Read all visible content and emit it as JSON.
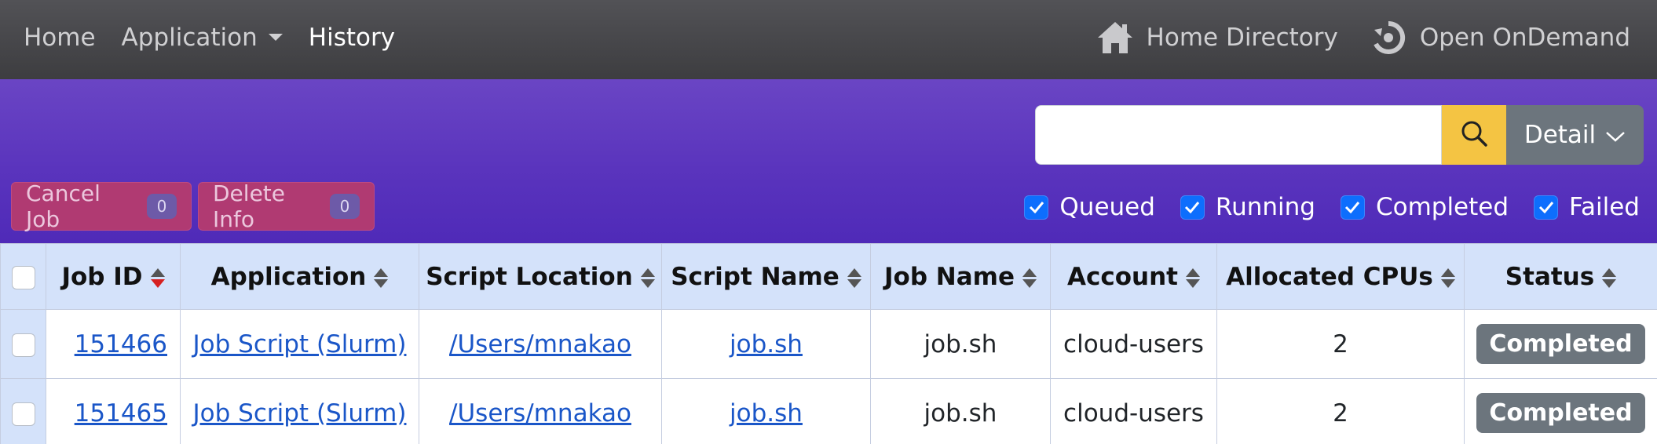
{
  "navbar": {
    "home": "Home",
    "application": "Application",
    "history": "History",
    "home_directory": "Home Directory",
    "open_ondemand": "Open OnDemand"
  },
  "toolbar": {
    "search_value": "",
    "detail_label": "Detail",
    "cancel_job": {
      "label": "Cancel Job",
      "count": "0"
    },
    "delete_info": {
      "label": "Delete Info",
      "count": "0"
    },
    "filters": [
      {
        "label": "Queued",
        "checked": true
      },
      {
        "label": "Running",
        "checked": true
      },
      {
        "label": "Completed",
        "checked": true
      },
      {
        "label": "Failed",
        "checked": true
      }
    ]
  },
  "table": {
    "headers": [
      "Job ID",
      "Application",
      "Script Location",
      "Script Name",
      "Job Name",
      "Account",
      "Allocated CPUs",
      "Status"
    ],
    "sorted_column": "Job ID",
    "sort_direction": "descending",
    "rows": [
      {
        "job_id": "151466",
        "application": "Job Script (Slurm)",
        "script_location": "/Users/mnakao",
        "script_name": "job.sh",
        "job_name": "job.sh",
        "account": "cloud-users",
        "cpus": "2",
        "status": "Completed"
      },
      {
        "job_id": "151465",
        "application": "Job Script (Slurm)",
        "script_location": "/Users/mnakao",
        "script_name": "job.sh",
        "job_name": "job.sh",
        "account": "cloud-users",
        "cpus": "2",
        "status": "Completed"
      }
    ]
  },
  "colors": {
    "navbar": "#48484b",
    "banner": "#5a34bd",
    "search_button": "#f4c443",
    "detail_button": "#6c757d",
    "action_button": "#b03a72",
    "checkbox": "#0d6efd",
    "table_header": "#d4e2fa",
    "status_badge": "#6c757d",
    "link": "#1a56c8"
  }
}
